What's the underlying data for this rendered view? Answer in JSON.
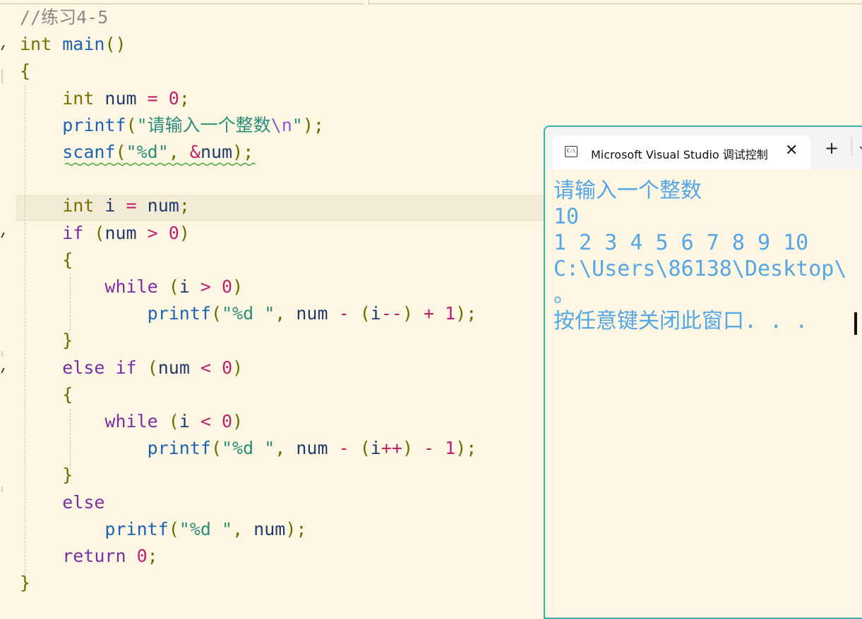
{
  "editor": {
    "lines": [
      {
        "segments": [
          {
            "t": "//练习4-5",
            "c": "cm"
          }
        ]
      },
      {
        "segments": [
          {
            "t": "int",
            "c": "ty"
          },
          {
            "t": " ",
            "c": "id"
          },
          {
            "t": "main",
            "c": "fn"
          },
          {
            "t": "()",
            "c": "pun"
          }
        ]
      },
      {
        "segments": [
          {
            "t": "{",
            "c": "pun"
          }
        ]
      },
      {
        "segments": [
          {
            "t": "    ",
            "c": "id"
          },
          {
            "t": "int",
            "c": "ty"
          },
          {
            "t": " num ",
            "c": "id"
          },
          {
            "t": "=",
            "c": "op"
          },
          {
            "t": " ",
            "c": "id"
          },
          {
            "t": "0",
            "c": "num"
          },
          {
            "t": ";",
            "c": "pun"
          }
        ]
      },
      {
        "segments": [
          {
            "t": "    ",
            "c": "id"
          },
          {
            "t": "printf",
            "c": "fn"
          },
          {
            "t": "(",
            "c": "pun"
          },
          {
            "t": "\"请输入一个整数",
            "c": "str"
          },
          {
            "t": "\\n",
            "c": "esc"
          },
          {
            "t": "\"",
            "c": "str"
          },
          {
            "t": ");",
            "c": "pun"
          }
        ]
      },
      {
        "segments": [
          {
            "t": "    ",
            "c": "id"
          },
          {
            "t": "scanf",
            "c": "fn"
          },
          {
            "t": "(",
            "c": "pun"
          },
          {
            "t": "\"%d\"",
            "c": "str"
          },
          {
            "t": ", ",
            "c": "pun"
          },
          {
            "t": "&",
            "c": "op"
          },
          {
            "t": "num",
            "c": "id"
          },
          {
            "t": ");",
            "c": "pun"
          }
        ]
      },
      {
        "segments": [
          {
            "t": "",
            "c": "id"
          }
        ]
      },
      {
        "segments": [
          {
            "t": "    ",
            "c": "id"
          },
          {
            "t": "int",
            "c": "ty"
          },
          {
            "t": " i ",
            "c": "id"
          },
          {
            "t": "=",
            "c": "op"
          },
          {
            "t": " num",
            "c": "id"
          },
          {
            "t": ";",
            "c": "pun"
          }
        ]
      },
      {
        "segments": [
          {
            "t": "    ",
            "c": "id"
          },
          {
            "t": "if",
            "c": "ctl"
          },
          {
            "t": " (",
            "c": "pun"
          },
          {
            "t": "num ",
            "c": "id"
          },
          {
            "t": ">",
            "c": "op"
          },
          {
            "t": " ",
            "c": "id"
          },
          {
            "t": "0",
            "c": "num"
          },
          {
            "t": ")",
            "c": "pun"
          }
        ]
      },
      {
        "segments": [
          {
            "t": "    ",
            "c": "id"
          },
          {
            "t": "{",
            "c": "pun"
          }
        ]
      },
      {
        "segments": [
          {
            "t": "        ",
            "c": "id"
          },
          {
            "t": "while",
            "c": "ctl"
          },
          {
            "t": " (",
            "c": "pun"
          },
          {
            "t": "i ",
            "c": "id"
          },
          {
            "t": ">",
            "c": "op"
          },
          {
            "t": " ",
            "c": "id"
          },
          {
            "t": "0",
            "c": "num"
          },
          {
            "t": ")",
            "c": "pun"
          }
        ]
      },
      {
        "segments": [
          {
            "t": "            ",
            "c": "id"
          },
          {
            "t": "printf",
            "c": "fn"
          },
          {
            "t": "(",
            "c": "pun"
          },
          {
            "t": "\"%d \"",
            "c": "str"
          },
          {
            "t": ", ",
            "c": "pun"
          },
          {
            "t": "num ",
            "c": "id"
          },
          {
            "t": "-",
            "c": "op"
          },
          {
            "t": " (",
            "c": "pun"
          },
          {
            "t": "i",
            "c": "id"
          },
          {
            "t": "--",
            "c": "op"
          },
          {
            "t": ") ",
            "c": "pun"
          },
          {
            "t": "+",
            "c": "op"
          },
          {
            "t": " ",
            "c": "id"
          },
          {
            "t": "1",
            "c": "num"
          },
          {
            "t": ");",
            "c": "pun"
          }
        ]
      },
      {
        "segments": [
          {
            "t": "    ",
            "c": "id"
          },
          {
            "t": "}",
            "c": "pun"
          }
        ]
      },
      {
        "segments": [
          {
            "t": "    ",
            "c": "id"
          },
          {
            "t": "else",
            "c": "ctl"
          },
          {
            "t": " ",
            "c": "id"
          },
          {
            "t": "if",
            "c": "ctl"
          },
          {
            "t": " (",
            "c": "pun"
          },
          {
            "t": "num ",
            "c": "id"
          },
          {
            "t": "<",
            "c": "op"
          },
          {
            "t": " ",
            "c": "id"
          },
          {
            "t": "0",
            "c": "num"
          },
          {
            "t": ")",
            "c": "pun"
          }
        ]
      },
      {
        "segments": [
          {
            "t": "    ",
            "c": "id"
          },
          {
            "t": "{",
            "c": "pun"
          }
        ]
      },
      {
        "segments": [
          {
            "t": "        ",
            "c": "id"
          },
          {
            "t": "while",
            "c": "ctl"
          },
          {
            "t": " (",
            "c": "pun"
          },
          {
            "t": "i ",
            "c": "id"
          },
          {
            "t": "<",
            "c": "op"
          },
          {
            "t": " ",
            "c": "id"
          },
          {
            "t": "0",
            "c": "num"
          },
          {
            "t": ")",
            "c": "pun"
          }
        ]
      },
      {
        "segments": [
          {
            "t": "            ",
            "c": "id"
          },
          {
            "t": "printf",
            "c": "fn"
          },
          {
            "t": "(",
            "c": "pun"
          },
          {
            "t": "\"%d \"",
            "c": "str"
          },
          {
            "t": ", ",
            "c": "pun"
          },
          {
            "t": "num ",
            "c": "id"
          },
          {
            "t": "-",
            "c": "op"
          },
          {
            "t": " (",
            "c": "pun"
          },
          {
            "t": "i",
            "c": "id"
          },
          {
            "t": "++",
            "c": "op"
          },
          {
            "t": ") ",
            "c": "pun"
          },
          {
            "t": "-",
            "c": "op"
          },
          {
            "t": " ",
            "c": "id"
          },
          {
            "t": "1",
            "c": "num"
          },
          {
            "t": ");",
            "c": "pun"
          }
        ]
      },
      {
        "segments": [
          {
            "t": "    ",
            "c": "id"
          },
          {
            "t": "}",
            "c": "pun"
          }
        ]
      },
      {
        "segments": [
          {
            "t": "    ",
            "c": "id"
          },
          {
            "t": "else",
            "c": "ctl"
          }
        ]
      },
      {
        "segments": [
          {
            "t": "        ",
            "c": "id"
          },
          {
            "t": "printf",
            "c": "fn"
          },
          {
            "t": "(",
            "c": "pun"
          },
          {
            "t": "\"%d \"",
            "c": "str"
          },
          {
            "t": ", ",
            "c": "pun"
          },
          {
            "t": "num",
            "c": "id"
          },
          {
            "t": ");",
            "c": "pun"
          }
        ]
      },
      {
        "segments": [
          {
            "t": "    ",
            "c": "id"
          },
          {
            "t": "return",
            "c": "ctl"
          },
          {
            "t": " ",
            "c": "id"
          },
          {
            "t": "0",
            "c": "num"
          },
          {
            "t": ";",
            "c": "pun"
          }
        ]
      },
      {
        "segments": [
          {
            "t": "}",
            "c": "pun"
          }
        ]
      }
    ]
  },
  "console": {
    "tab_title": "Microsoft Visual Studio 调试控制台",
    "tab_icon_text": "C:\\",
    "close_glyph": "✕",
    "new_tab_glyph": "+",
    "dropdown_glyph": "⌄",
    "output": [
      "请输入一个整数",
      "10",
      "1 2 3 4 5 6 7 8 9 10",
      "C:\\Users\\86138\\Desktop\\",
      "。",
      "按任意键关闭此窗口. . ."
    ]
  },
  "colors": {
    "editor_bg": "#fdf6e3",
    "console_border": "#3ab0a5",
    "console_text": "#55a6e6"
  }
}
